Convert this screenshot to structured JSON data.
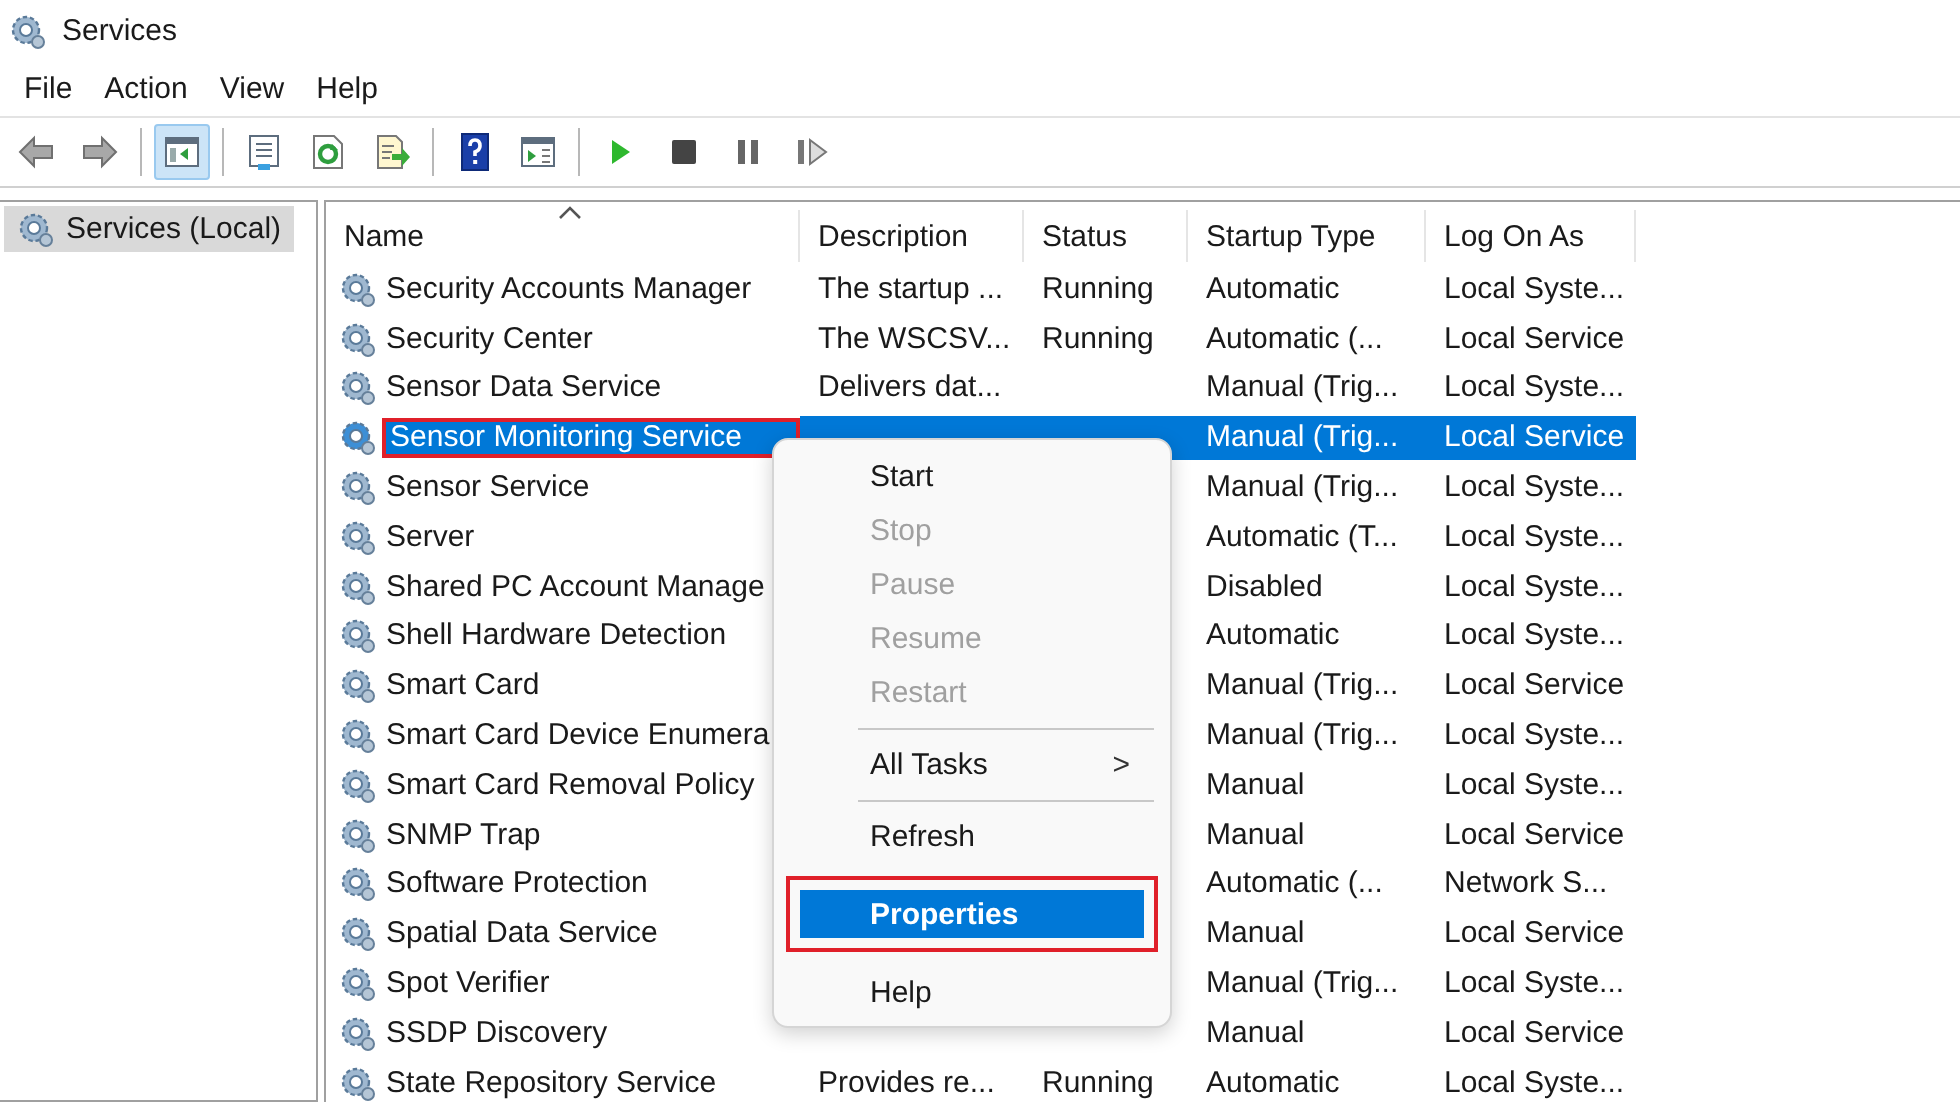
{
  "window": {
    "title": "Services"
  },
  "menu_bar": [
    "File",
    "Action",
    "View",
    "Help"
  ],
  "toolbar": [
    {
      "kind": "back",
      "pressed": false
    },
    {
      "kind": "forward",
      "pressed": false
    },
    {
      "kind": "separator"
    },
    {
      "kind": "console",
      "pressed": true
    },
    {
      "kind": "separator"
    },
    {
      "kind": "properties",
      "pressed": false
    },
    {
      "kind": "refresh",
      "pressed": false
    },
    {
      "kind": "export",
      "pressed": false
    },
    {
      "kind": "separator"
    },
    {
      "kind": "help",
      "pressed": false
    },
    {
      "kind": "actionpane",
      "pressed": false
    },
    {
      "kind": "separator"
    },
    {
      "kind": "start",
      "pressed": false
    },
    {
      "kind": "stop",
      "pressed": false
    },
    {
      "kind": "pause",
      "pressed": false
    },
    {
      "kind": "resume",
      "pressed": false
    }
  ],
  "tree": {
    "items": [
      {
        "label": "Services (Local)",
        "selected": true
      }
    ]
  },
  "table": {
    "columns": [
      "Name",
      "Description",
      "Status",
      "Startup Type",
      "Log On As"
    ],
    "rows": [
      {
        "name": "Security Accounts Manager",
        "description": "The startup ...",
        "status": "Running",
        "startup_type": "Automatic",
        "log_on_as": "Local Syste...",
        "selected": false,
        "annotated": false
      },
      {
        "name": "Security Center",
        "description": "The WSCSV...",
        "status": "Running",
        "startup_type": "Automatic (...",
        "log_on_as": "Local Service",
        "selected": false,
        "annotated": false
      },
      {
        "name": "Sensor Data Service",
        "description": "Delivers dat...",
        "startup_type": "Manual (Trig...",
        "log_on_as": "Local Syste...",
        "selected": false,
        "annotated": false
      },
      {
        "name": "Sensor Monitoring Service",
        "startup_type": "Manual (Trig...",
        "log_on_as": "Local Service",
        "selected": true,
        "annotated": true
      },
      {
        "name": "Sensor Service",
        "startup_type": "Manual (Trig...",
        "log_on_as": "Local Syste...",
        "selected": false,
        "annotated": false
      },
      {
        "name": "Server",
        "startup_type": "Automatic (T...",
        "log_on_as": "Local Syste...",
        "selected": false,
        "annotated": false
      },
      {
        "name": "Shared PC Account Manage",
        "startup_type": "Disabled",
        "log_on_as": "Local Syste...",
        "selected": false,
        "annotated": false
      },
      {
        "name": "Shell Hardware Detection",
        "startup_type": "Automatic",
        "log_on_as": "Local Syste...",
        "selected": false,
        "annotated": false
      },
      {
        "name": "Smart Card",
        "startup_type": "Manual (Trig...",
        "log_on_as": "Local Service",
        "selected": false,
        "annotated": false
      },
      {
        "name": "Smart Card Device Enumera",
        "startup_type": "Manual (Trig...",
        "log_on_as": "Local Syste...",
        "selected": false,
        "annotated": false
      },
      {
        "name": "Smart Card Removal Policy",
        "startup_type": "Manual",
        "log_on_as": "Local Syste...",
        "selected": false,
        "annotated": false
      },
      {
        "name": "SNMP Trap",
        "startup_type": "Manual",
        "log_on_as": "Local Service",
        "selected": false,
        "annotated": false
      },
      {
        "name": "Software Protection",
        "startup_type": "Automatic (...",
        "log_on_as": "Network S...",
        "selected": false,
        "annotated": false
      },
      {
        "name": "Spatial Data Service",
        "startup_type": "Manual",
        "log_on_as": "Local Service",
        "selected": false,
        "annotated": false
      },
      {
        "name": "Spot Verifier",
        "startup_type": "Manual (Trig...",
        "log_on_as": "Local Syste...",
        "selected": false,
        "annotated": false
      },
      {
        "name": "SSDP Discovery",
        "startup_type": "Manual",
        "log_on_as": "Local Service",
        "selected": false,
        "annotated": false
      },
      {
        "name": "State Repository Service",
        "description": "Provides re...",
        "status": "Running",
        "startup_type": "Automatic",
        "log_on_as": "Local Syste...",
        "selected": false,
        "annotated": false
      }
    ]
  },
  "context_menu": {
    "items": [
      {
        "kind": "item",
        "label": "Start",
        "disabled": false,
        "selected": false,
        "annotated": false
      },
      {
        "kind": "item",
        "label": "Stop",
        "disabled": true,
        "selected": false,
        "annotated": false
      },
      {
        "kind": "item",
        "label": "Pause",
        "disabled": true,
        "selected": false,
        "annotated": false
      },
      {
        "kind": "item",
        "label": "Resume",
        "disabled": true,
        "selected": false,
        "annotated": false
      },
      {
        "kind": "item",
        "label": "Restart",
        "disabled": true,
        "selected": false,
        "annotated": false
      },
      {
        "kind": "separator"
      },
      {
        "kind": "submenu",
        "label": "All Tasks",
        "arrow": ">",
        "disabled": false,
        "selected": false,
        "annotated": false
      },
      {
        "kind": "separator"
      },
      {
        "kind": "item",
        "label": "Refresh",
        "disabled": false,
        "selected": false,
        "annotated": false
      },
      {
        "kind": "item",
        "label": "Properties",
        "disabled": false,
        "selected": true,
        "annotated": true
      },
      {
        "kind": "item",
        "label": "Help",
        "disabled": false,
        "selected": false,
        "annotated": false
      }
    ]
  }
}
